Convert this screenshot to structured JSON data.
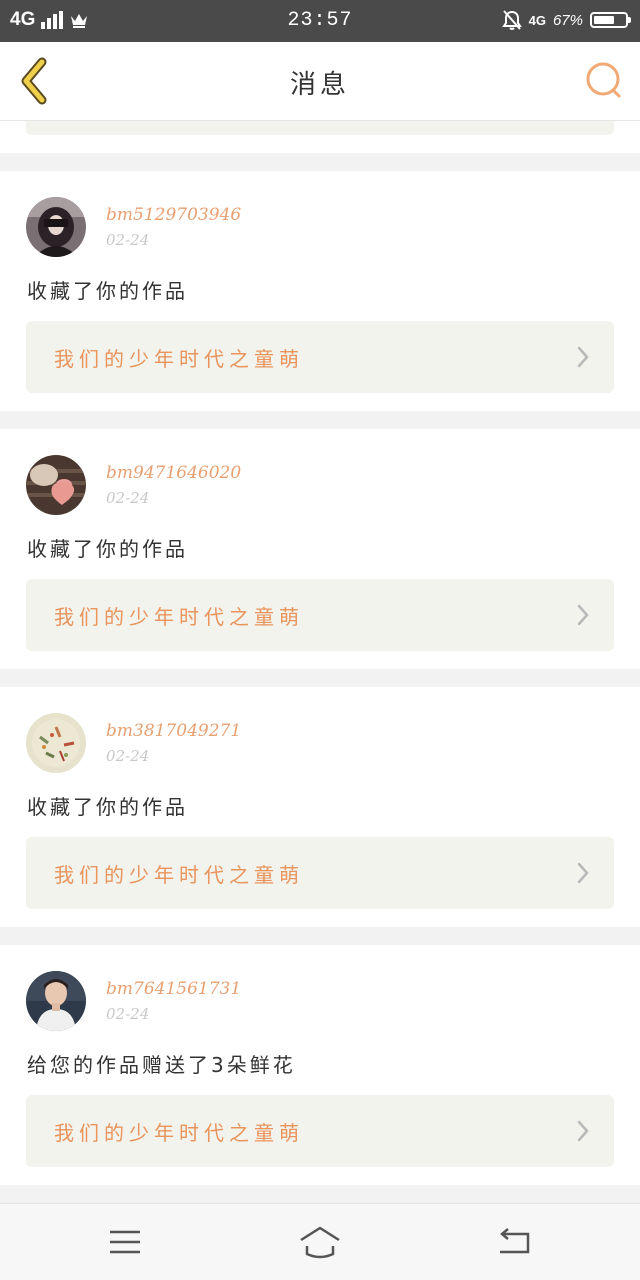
{
  "status_bar": {
    "network": "4G",
    "network_small": "4G",
    "time": "23:57",
    "battery": "67%",
    "battery_level": 0.67
  },
  "header": {
    "title": "消息"
  },
  "messages": [
    {
      "username": "bm5129703946",
      "date": "02-24",
      "action": "收藏了你的作品",
      "work_title": "我们的少年时代之童萌"
    },
    {
      "username": "bm9471646020",
      "date": "02-24",
      "action": "收藏了你的作品",
      "work_title": "我们的少年时代之童萌"
    },
    {
      "username": "bm3817049271",
      "date": "02-24",
      "action": "收藏了你的作品",
      "work_title": "我们的少年时代之童萌"
    },
    {
      "username": "bm7641561731",
      "date": "02-24",
      "action": "给您的作品赠送了3朵鲜花",
      "work_title": "我们的少年时代之童萌"
    }
  ],
  "colors": {
    "accent": "#e8945c",
    "back_arrow": "#f0d04a",
    "card_bg": "#f3f3ed"
  },
  "icons": {
    "back": "chevron-left-icon",
    "search": "search-icon",
    "menu": "menu-icon",
    "home": "home-icon",
    "return": "return-icon"
  }
}
